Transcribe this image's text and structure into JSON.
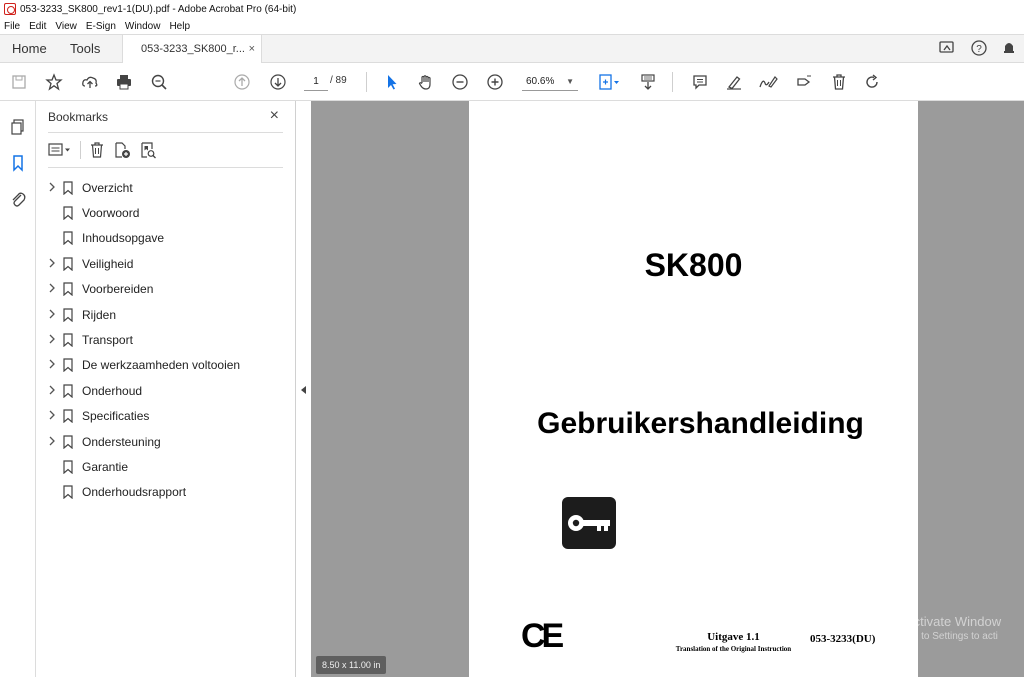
{
  "window": {
    "title": "053-3233_SK800_rev1-1(DU).pdf - Adobe Acrobat Pro (64-bit)"
  },
  "menu": {
    "items": [
      "File",
      "Edit",
      "View",
      "E-Sign",
      "Window",
      "Help"
    ]
  },
  "tabs": {
    "home": "Home",
    "tools": "Tools",
    "doc": "053-3233_SK800_r...",
    "close": "×"
  },
  "toolbar": {
    "page_current": "1",
    "page_total": "/ 89",
    "zoom": "60.6%"
  },
  "bookmarks": {
    "title": "Bookmarks",
    "close": "×",
    "items": [
      {
        "label": "Overzicht",
        "expandable": true
      },
      {
        "label": "Voorwoord",
        "expandable": false
      },
      {
        "label": "Inhoudsopgave",
        "expandable": false
      },
      {
        "label": "Veiligheid",
        "expandable": true
      },
      {
        "label": "Voorbereiden",
        "expandable": true
      },
      {
        "label": "Rijden",
        "expandable": true
      },
      {
        "label": "Transport",
        "expandable": true
      },
      {
        "label": "De werkzaamheden voltooien",
        "expandable": true
      },
      {
        "label": "Onderhoud",
        "expandable": true
      },
      {
        "label": "Specificaties",
        "expandable": true
      },
      {
        "label": "Ondersteuning",
        "expandable": true
      },
      {
        "label": "Garantie",
        "expandable": false
      },
      {
        "label": "Onderhoudsrapport",
        "expandable": false
      }
    ]
  },
  "document": {
    "title": "SK800",
    "subtitle": "Gebruikershandleiding",
    "ce_mark": "CE",
    "edition": "Uitgave 1.1",
    "translation_note": "Translation of the Original Instruction",
    "doc_number": "053-3233(DU)",
    "page_size": "8.50 x 11.00 in"
  },
  "watermark": {
    "line1": "Activate Window",
    "line2": "Go to Settings to acti"
  },
  "colors": {
    "accent": "#1473e6",
    "pdf_red": "#d0201a",
    "canvas": "#9b9b9b"
  }
}
